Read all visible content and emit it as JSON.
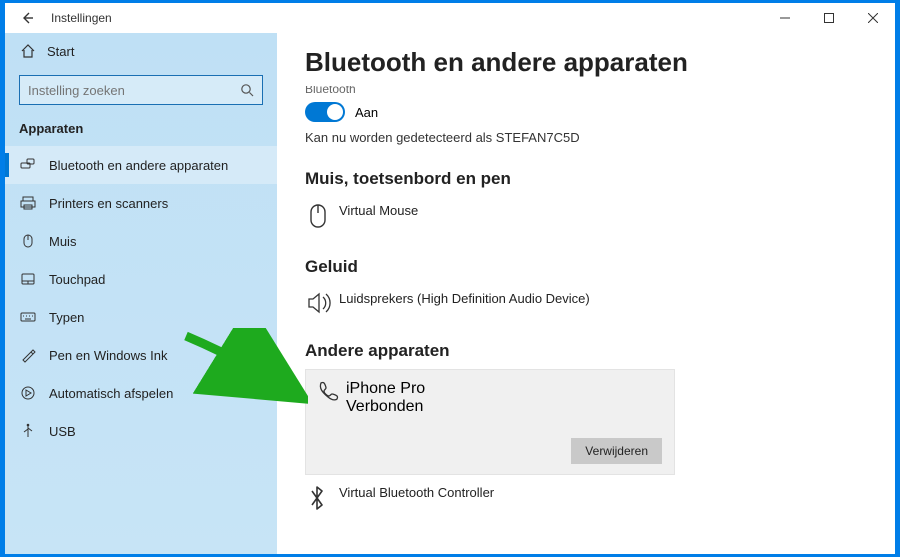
{
  "titlebar": {
    "title": "Instellingen"
  },
  "sidebar": {
    "home": "Start",
    "search_placeholder": "Instelling zoeken",
    "category": "Apparaten",
    "items": [
      {
        "label": "Bluetooth en andere apparaten",
        "icon": "keyboard-mouse"
      },
      {
        "label": "Printers en scanners",
        "icon": "printer"
      },
      {
        "label": "Muis",
        "icon": "mouse"
      },
      {
        "label": "Touchpad",
        "icon": "touchpad"
      },
      {
        "label": "Typen",
        "icon": "keyboard"
      },
      {
        "label": "Pen en Windows Ink",
        "icon": "pen"
      },
      {
        "label": "Automatisch afspelen",
        "icon": "autoplay"
      },
      {
        "label": "USB",
        "icon": "usb"
      }
    ]
  },
  "content": {
    "page_title": "Bluetooth en andere apparaten",
    "clipped_label": "Bluetooth",
    "toggle_state": "Aan",
    "detect_text": "Kan nu worden gedetecteerd als STEFAN7C5D",
    "sections": {
      "mouse_kb_pen": {
        "heading": "Muis, toetsenbord en pen",
        "devices": [
          {
            "name": "Virtual Mouse"
          }
        ]
      },
      "audio": {
        "heading": "Geluid",
        "devices": [
          {
            "name": "Luidsprekers (High Definition Audio Device)"
          }
        ]
      },
      "other": {
        "heading": "Andere apparaten",
        "selected": {
          "name": "iPhone Pro",
          "status": "Verbonden",
          "remove_label": "Verwijderen"
        },
        "devices": [
          {
            "name": "Virtual Bluetooth Controller"
          }
        ]
      }
    }
  }
}
